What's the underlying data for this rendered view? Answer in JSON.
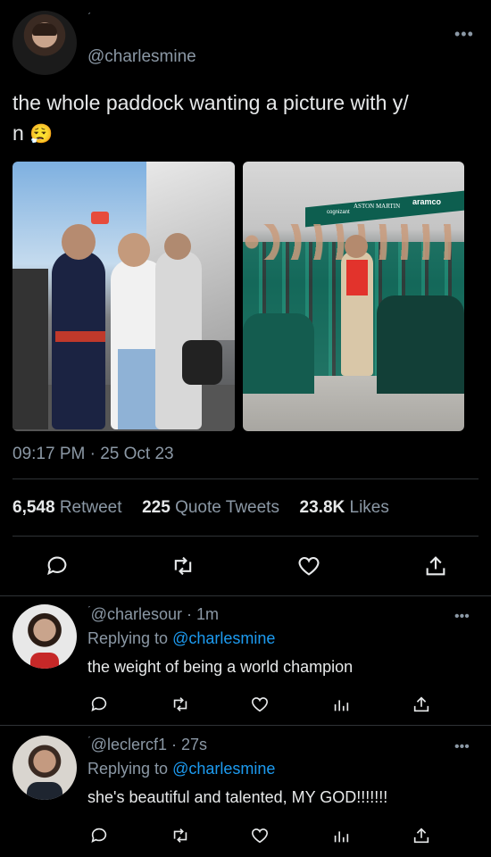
{
  "main_tweet": {
    "handle": "@charlesmine",
    "text_line1": "the whole paddock wanting a picture with y/",
    "text_line2": "n",
    "emoji": "😮‍💨",
    "timestamp": "09:17 PM · 25 Oct 23",
    "stats": {
      "retweets_count": "6,548",
      "retweets_label": "Retweet",
      "quotes_count": "225",
      "quotes_label": "Quote Tweets",
      "likes_count": "23.8K",
      "likes_label": "Likes"
    },
    "photo2_banner": "ASTON MARTIN",
    "photo2_sponsor": "aramco",
    "photo2_sponsor2": "cognizant"
  },
  "replies": [
    {
      "handle": "@charlesour",
      "time": "1m",
      "replying_label": "Replying to",
      "replying_to": "@charlesmine",
      "text": "the weight of being a world champion"
    },
    {
      "handle": "@leclercf1",
      "time": "27s",
      "replying_label": "Replying to",
      "replying_to": "@charlesmine",
      "text": "she's beautiful and talented, MY GOD!!!!!!!"
    }
  ],
  "icons": [
    "reply-icon",
    "retweet-icon",
    "like-icon",
    "share-icon",
    "analytics-icon",
    "more-icon"
  ],
  "colors": {
    "background": "#000000",
    "text": "#e7e9ea",
    "muted": "#8b98a5",
    "link": "#1d9bf0",
    "divider": "#2f3336"
  }
}
